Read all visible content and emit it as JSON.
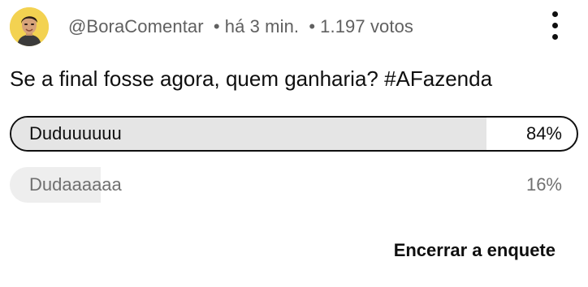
{
  "post": {
    "author": "@BoraComentar",
    "separator": "•",
    "time": "há 3 min.",
    "votes": "1.197 votos",
    "menu_icon": "more-vertical-icon"
  },
  "poll": {
    "question": "Se a final fosse agora, quem ganharia? #AFazenda",
    "options": [
      {
        "label": "Duduuuuuu",
        "percent_text": "84%",
        "percent": 84,
        "selected": true
      },
      {
        "label": "Dudaaaaaa",
        "percent_text": "16%",
        "percent": 16,
        "selected": false
      }
    ],
    "end_label": "Encerrar a enquete"
  },
  "colors": {
    "fill_selected": "#e5e5e5",
    "fill_other": "#eeeeee",
    "text_primary": "#0f0f0f",
    "text_secondary": "#606060",
    "avatar_background": "#f3d251"
  }
}
